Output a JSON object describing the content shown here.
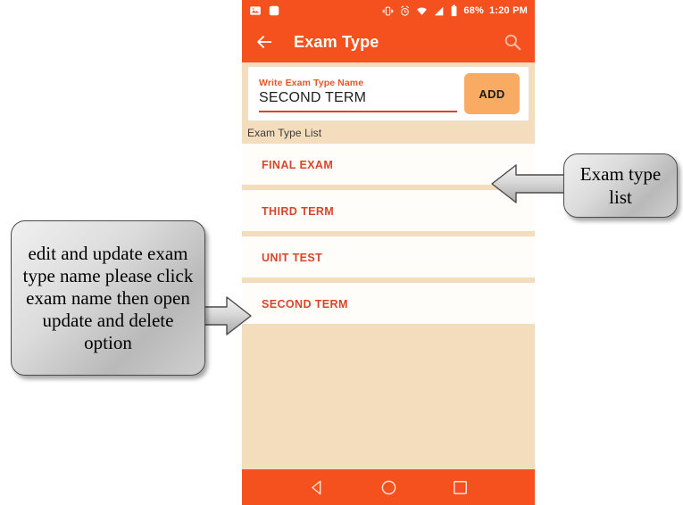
{
  "phone": {
    "statusbar": {
      "icons_left": [
        "image-icon",
        "rounded-square-icon"
      ],
      "icons_right": [
        "vibrate-icon",
        "alarm-icon",
        "wifi-icon",
        "signal-icon",
        "battery-icon"
      ],
      "battery_percent": "68%",
      "time": "1:20 PM"
    },
    "appbar": {
      "back_icon": "back-arrow-icon",
      "title": "Exam Type",
      "search_icon": "search-icon"
    },
    "input_card": {
      "label": "Write Exam Type Name",
      "value": "SECOND TERM",
      "placeholder": "Write Exam Type Name",
      "add_label": "ADD"
    },
    "list": {
      "header": "Exam Type List",
      "items": [
        {
          "label": "FINAL EXAM"
        },
        {
          "label": "THIRD TERM"
        },
        {
          "label": "UNIT TEST"
        },
        {
          "label": "SECOND TERM"
        }
      ]
    },
    "navbar": {
      "back_icon": "nav-back-triangle-icon",
      "home_icon": "nav-home-circle-icon",
      "recents_icon": "nav-recents-square-icon"
    }
  },
  "annotations": {
    "left_callout": "edit and update exam type name please click exam name then open update and delete option",
    "right_callout": "Exam type list"
  },
  "colors": {
    "primary_orange": "#f4511e",
    "accent_button": "#f9ab63",
    "page_background": "#f4ddbc",
    "list_text": "#d8452b",
    "label_text": "#e4572e"
  }
}
